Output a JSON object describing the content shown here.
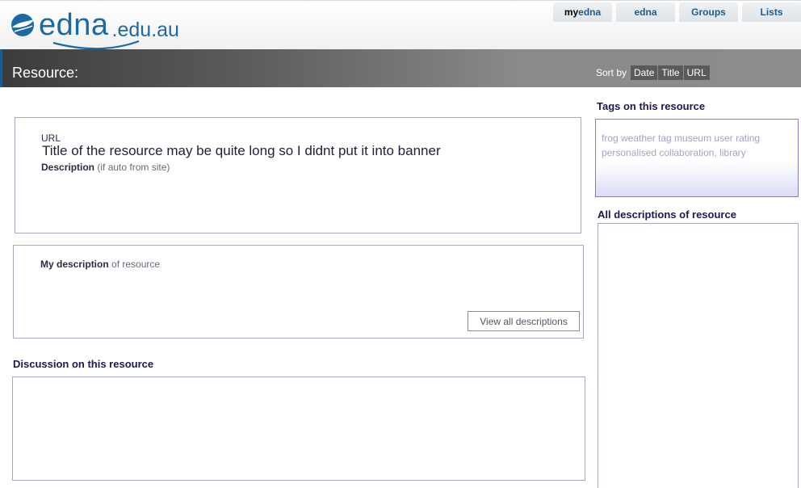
{
  "header": {
    "logo_main": "edna",
    "logo_domain": ".edu.au",
    "tabs": [
      {
        "prefix": "my",
        "label": "edna"
      },
      {
        "prefix": "",
        "label": "edna"
      },
      {
        "prefix": "",
        "label": "Groups"
      },
      {
        "prefix": "",
        "label": "Lists"
      }
    ]
  },
  "banner": {
    "title": "Resource:",
    "sort_label": "Sort by",
    "sort_options": [
      "Date",
      "Title",
      "URL"
    ]
  },
  "resource": {
    "url_label": "URL",
    "title": "Title of the resource may be quite long so I didnt put it into banner",
    "description_label": "Description",
    "description_note": "(if auto from site)"
  },
  "my_description": {
    "label": "My description",
    "note": "of resource",
    "button": "View all descriptions"
  },
  "discussion": {
    "heading": "Discussion on this resource"
  },
  "tags": {
    "heading": "Tags on this resource",
    "text": "frog weather tag museum user rating personalised collaboration, library"
  },
  "all_descriptions": {
    "heading": "All descriptions of resource"
  },
  "colors": {
    "brand": "#1c6aa3",
    "heading": "#1a1a52",
    "box_border": "#a7a9bc"
  }
}
